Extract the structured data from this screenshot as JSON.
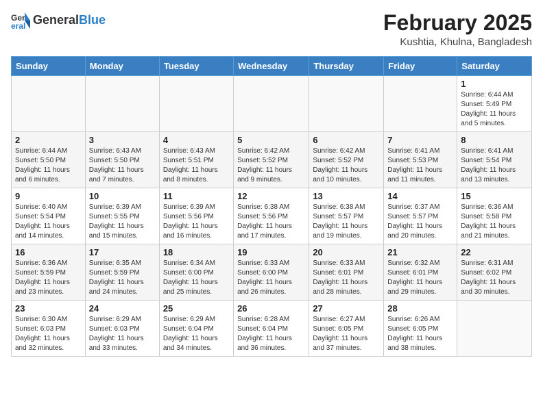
{
  "header": {
    "logo_general": "General",
    "logo_blue": "Blue",
    "title": "February 2025",
    "subtitle": "Kushtia, Khulna, Bangladesh"
  },
  "weekdays": [
    "Sunday",
    "Monday",
    "Tuesday",
    "Wednesday",
    "Thursday",
    "Friday",
    "Saturday"
  ],
  "weeks": [
    [
      {
        "day": "",
        "info": ""
      },
      {
        "day": "",
        "info": ""
      },
      {
        "day": "",
        "info": ""
      },
      {
        "day": "",
        "info": ""
      },
      {
        "day": "",
        "info": ""
      },
      {
        "day": "",
        "info": ""
      },
      {
        "day": "1",
        "info": "Sunrise: 6:44 AM\nSunset: 5:49 PM\nDaylight: 11 hours\nand 5 minutes."
      }
    ],
    [
      {
        "day": "2",
        "info": "Sunrise: 6:44 AM\nSunset: 5:50 PM\nDaylight: 11 hours\nand 6 minutes."
      },
      {
        "day": "3",
        "info": "Sunrise: 6:43 AM\nSunset: 5:50 PM\nDaylight: 11 hours\nand 7 minutes."
      },
      {
        "day": "4",
        "info": "Sunrise: 6:43 AM\nSunset: 5:51 PM\nDaylight: 11 hours\nand 8 minutes."
      },
      {
        "day": "5",
        "info": "Sunrise: 6:42 AM\nSunset: 5:52 PM\nDaylight: 11 hours\nand 9 minutes."
      },
      {
        "day": "6",
        "info": "Sunrise: 6:42 AM\nSunset: 5:52 PM\nDaylight: 11 hours\nand 10 minutes."
      },
      {
        "day": "7",
        "info": "Sunrise: 6:41 AM\nSunset: 5:53 PM\nDaylight: 11 hours\nand 11 minutes."
      },
      {
        "day": "8",
        "info": "Sunrise: 6:41 AM\nSunset: 5:54 PM\nDaylight: 11 hours\nand 13 minutes."
      }
    ],
    [
      {
        "day": "9",
        "info": "Sunrise: 6:40 AM\nSunset: 5:54 PM\nDaylight: 11 hours\nand 14 minutes."
      },
      {
        "day": "10",
        "info": "Sunrise: 6:39 AM\nSunset: 5:55 PM\nDaylight: 11 hours\nand 15 minutes."
      },
      {
        "day": "11",
        "info": "Sunrise: 6:39 AM\nSunset: 5:56 PM\nDaylight: 11 hours\nand 16 minutes."
      },
      {
        "day": "12",
        "info": "Sunrise: 6:38 AM\nSunset: 5:56 PM\nDaylight: 11 hours\nand 17 minutes."
      },
      {
        "day": "13",
        "info": "Sunrise: 6:38 AM\nSunset: 5:57 PM\nDaylight: 11 hours\nand 19 minutes."
      },
      {
        "day": "14",
        "info": "Sunrise: 6:37 AM\nSunset: 5:57 PM\nDaylight: 11 hours\nand 20 minutes."
      },
      {
        "day": "15",
        "info": "Sunrise: 6:36 AM\nSunset: 5:58 PM\nDaylight: 11 hours\nand 21 minutes."
      }
    ],
    [
      {
        "day": "16",
        "info": "Sunrise: 6:36 AM\nSunset: 5:59 PM\nDaylight: 11 hours\nand 23 minutes."
      },
      {
        "day": "17",
        "info": "Sunrise: 6:35 AM\nSunset: 5:59 PM\nDaylight: 11 hours\nand 24 minutes."
      },
      {
        "day": "18",
        "info": "Sunrise: 6:34 AM\nSunset: 6:00 PM\nDaylight: 11 hours\nand 25 minutes."
      },
      {
        "day": "19",
        "info": "Sunrise: 6:33 AM\nSunset: 6:00 PM\nDaylight: 11 hours\nand 26 minutes."
      },
      {
        "day": "20",
        "info": "Sunrise: 6:33 AM\nSunset: 6:01 PM\nDaylight: 11 hours\nand 28 minutes."
      },
      {
        "day": "21",
        "info": "Sunrise: 6:32 AM\nSunset: 6:01 PM\nDaylight: 11 hours\nand 29 minutes."
      },
      {
        "day": "22",
        "info": "Sunrise: 6:31 AM\nSunset: 6:02 PM\nDaylight: 11 hours\nand 30 minutes."
      }
    ],
    [
      {
        "day": "23",
        "info": "Sunrise: 6:30 AM\nSunset: 6:03 PM\nDaylight: 11 hours\nand 32 minutes."
      },
      {
        "day": "24",
        "info": "Sunrise: 6:29 AM\nSunset: 6:03 PM\nDaylight: 11 hours\nand 33 minutes."
      },
      {
        "day": "25",
        "info": "Sunrise: 6:29 AM\nSunset: 6:04 PM\nDaylight: 11 hours\nand 34 minutes."
      },
      {
        "day": "26",
        "info": "Sunrise: 6:28 AM\nSunset: 6:04 PM\nDaylight: 11 hours\nand 36 minutes."
      },
      {
        "day": "27",
        "info": "Sunrise: 6:27 AM\nSunset: 6:05 PM\nDaylight: 11 hours\nand 37 minutes."
      },
      {
        "day": "28",
        "info": "Sunrise: 6:26 AM\nSunset: 6:05 PM\nDaylight: 11 hours\nand 38 minutes."
      },
      {
        "day": "",
        "info": ""
      }
    ]
  ]
}
